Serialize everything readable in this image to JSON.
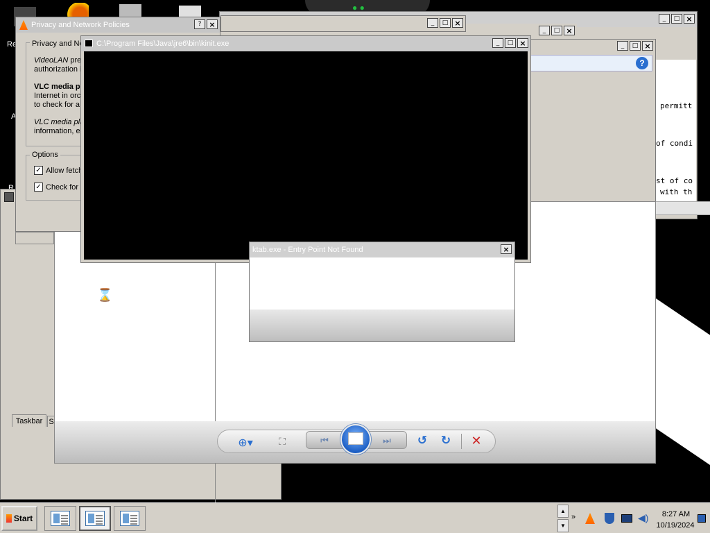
{
  "vlc_dialog": {
    "title": "Privacy and Network Policies",
    "group_title": "Privacy and Ne",
    "p1_italic": "VideoLAN",
    "p1_rest": " pref",
    "p1_line2": "authorization i",
    "p2_bold": "VLC media p",
    "p2_line2": "Internet in orc",
    "p2_line3": "to check for a",
    "p3_italic": "VLC media pla",
    "p3_line2": "information, e",
    "options_title": "Options",
    "option1": "Allow fetch",
    "option2": "Check for"
  },
  "back_window": {
    "text_lines": [
      "permitt",
      "of condi",
      "st of co",
      "with th"
    ]
  },
  "kinit": {
    "title": "C:\\Program Files\\Java\\jre6\\bin\\kinit.exe"
  },
  "ktab": {
    "title": "ktab.exe - Entry Point Not Found",
    "close": "×"
  },
  "left_panel": {
    "tab1": "Taskbar",
    "tab2": "S"
  },
  "desktop_letters": [
    "Re",
    "A",
    "R"
  ],
  "taskbar": {
    "start_label": "Start",
    "clock_time": "8:27 AM",
    "clock_date": "10/19/2024"
  },
  "window_buttons": {
    "min": "_",
    "max": "□",
    "close": "×",
    "help": "?"
  },
  "colors": {
    "accent_blue": "#2a6fd0",
    "close_red": "#cc2222",
    "console_bg": "#000000"
  }
}
